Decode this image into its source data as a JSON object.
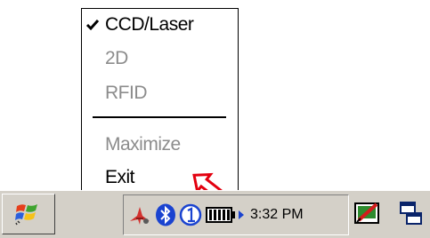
{
  "menu": {
    "items": [
      {
        "label": "CCD/Laser",
        "checked": true,
        "enabled": true
      },
      {
        "label": "2D",
        "checked": false,
        "enabled": false
      },
      {
        "label": "RFID",
        "checked": false,
        "enabled": false
      },
      {
        "label": "Maximize",
        "checked": false,
        "enabled": false
      },
      {
        "label": "Exit",
        "checked": false,
        "enabled": true
      }
    ]
  },
  "taskbar": {
    "clock": "3:32 PM",
    "tray_icons": [
      "scanner-app-icon",
      "bluetooth-icon",
      "numeric-1-icon",
      "battery-icon",
      "tray-arrow-icon"
    ],
    "buttons": [
      "start-windows-flag-icon",
      "input-panel-pen-icon",
      "show-desktop-icon"
    ]
  },
  "colors": {
    "disabled_text": "#8c8c8c",
    "taskbar_bg": "#d4d0c8",
    "bluetooth_blue": "#1a43d0",
    "pointer_red": "#e3000f"
  }
}
